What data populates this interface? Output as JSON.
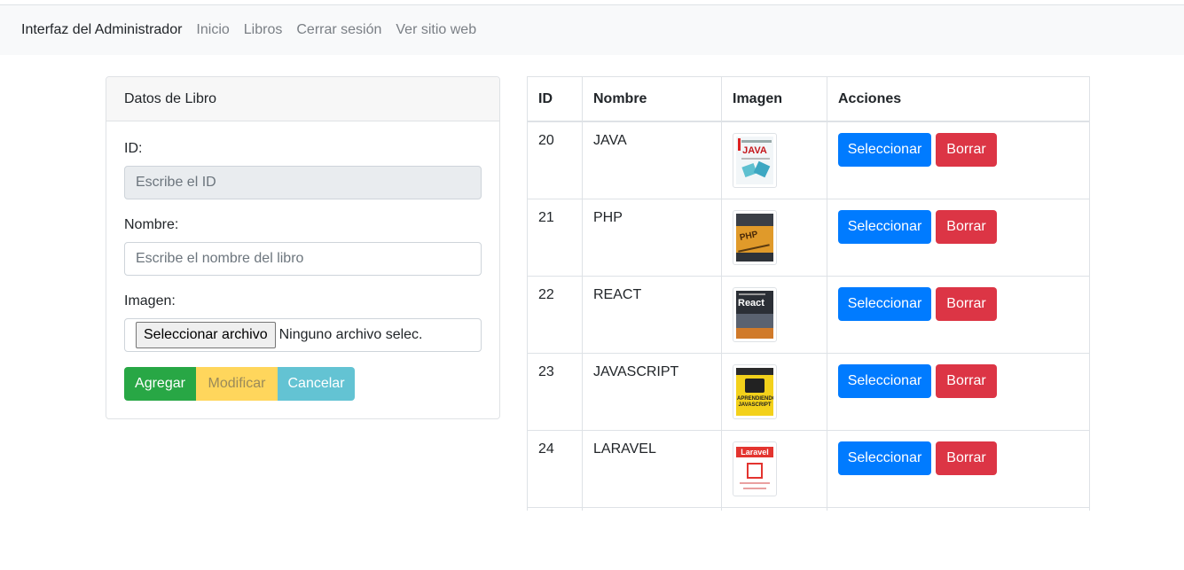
{
  "navbar": {
    "brand": "Interfaz del Administrador",
    "links": [
      "Inicio",
      "Libros",
      "Cerrar sesión",
      "Ver sitio web"
    ]
  },
  "form": {
    "header": "Datos de Libro",
    "id_label": "ID:",
    "id_placeholder": "Escribe el ID",
    "name_label": "Nombre:",
    "name_placeholder": "Escribe el nombre del libro",
    "image_label": "Imagen:",
    "file_button": "Seleccionar archivo",
    "file_status": "Ninguno archivo selec.",
    "buttons": {
      "add": "Agregar",
      "modify": "Modificar",
      "cancel": "Cancelar"
    }
  },
  "table": {
    "headers": [
      "ID",
      "Nombre",
      "Imagen",
      "Acciones"
    ],
    "rows": [
      {
        "id": "20",
        "name": "JAVA",
        "cover_text": "JAVA"
      },
      {
        "id": "21",
        "name": "PHP",
        "cover_text": "PHP"
      },
      {
        "id": "22",
        "name": "REACT",
        "cover_text": "React"
      },
      {
        "id": "23",
        "name": "JAVASCRIPT",
        "cover_text": "APRENDIENDO JAVASCRIPT"
      },
      {
        "id": "24",
        "name": "LARAVEL",
        "cover_text": "Laravel"
      }
    ],
    "select_label": "Seleccionar",
    "delete_label": "Borrar"
  },
  "colors": {
    "primary": "#007bff",
    "danger": "#dc3545",
    "success": "#28a745",
    "warning": "#ffd65c",
    "info": "#63c3d3"
  }
}
